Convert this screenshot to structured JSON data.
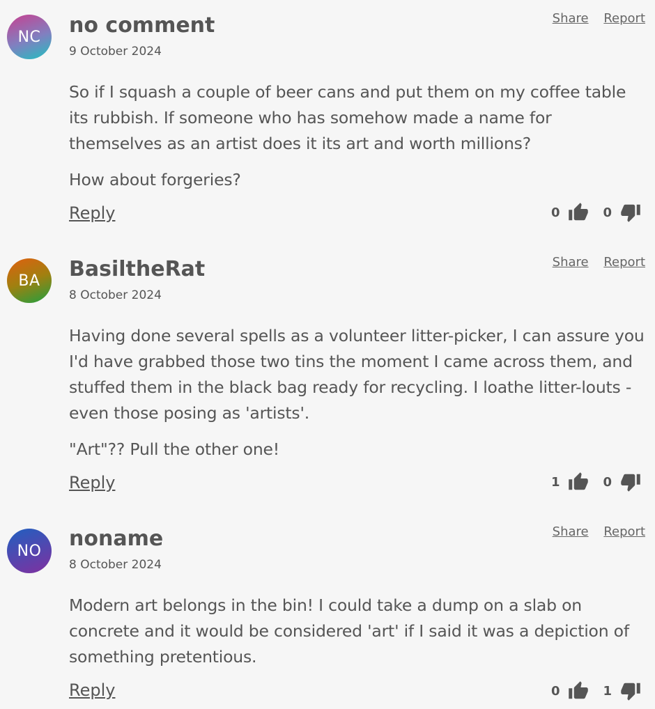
{
  "comments": [
    {
      "initials": "NC",
      "gradient": [
        "#c84090",
        "#20c0c0"
      ],
      "username": "no comment",
      "date": "9 October 2024",
      "share": "Share",
      "report": "Report",
      "paragraphs": [
        "So if I squash a couple of beer cans and put them on my coffee table its rubbish. If someone who has somehow made a name for themselves as an artist does it its art and worth millions?",
        "How about forgeries?"
      ],
      "reply": "Reply",
      "likes": "0",
      "dislikes": "0"
    },
    {
      "initials": "BA",
      "gradient": [
        "#e06010",
        "#20a040"
      ],
      "username": "BasiltheRat",
      "date": "8 October 2024",
      "share": "Share",
      "report": "Report",
      "paragraphs": [
        "Having done several spells as a volunteer litter-picker, I can assure you I'd have grabbed those two tins the moment I came across them, and stuffed them in the black bag ready for recycling. I loathe litter-louts - even those posing as 'artists'.",
        "\"Art\"?? Pull the other one!"
      ],
      "reply": "Reply",
      "likes": "1",
      "dislikes": "0"
    },
    {
      "initials": "NO",
      "gradient": [
        "#2060c0",
        "#8030a0"
      ],
      "username": "noname",
      "date": "8 October 2024",
      "share": "Share",
      "report": "Report",
      "paragraphs": [
        "Modern art belongs in the bin! I could take a dump on a slab on concrete and it would be considered 'art' if I said it was a depiction of something pretentious."
      ],
      "reply": "Reply",
      "likes": "0",
      "dislikes": "1"
    }
  ],
  "icons": {
    "like": "thumbs-up-icon",
    "dislike": "thumbs-down-icon"
  },
  "colors": {
    "text": "#555555",
    "background": "#f6f6f6",
    "icon": "#555555"
  }
}
